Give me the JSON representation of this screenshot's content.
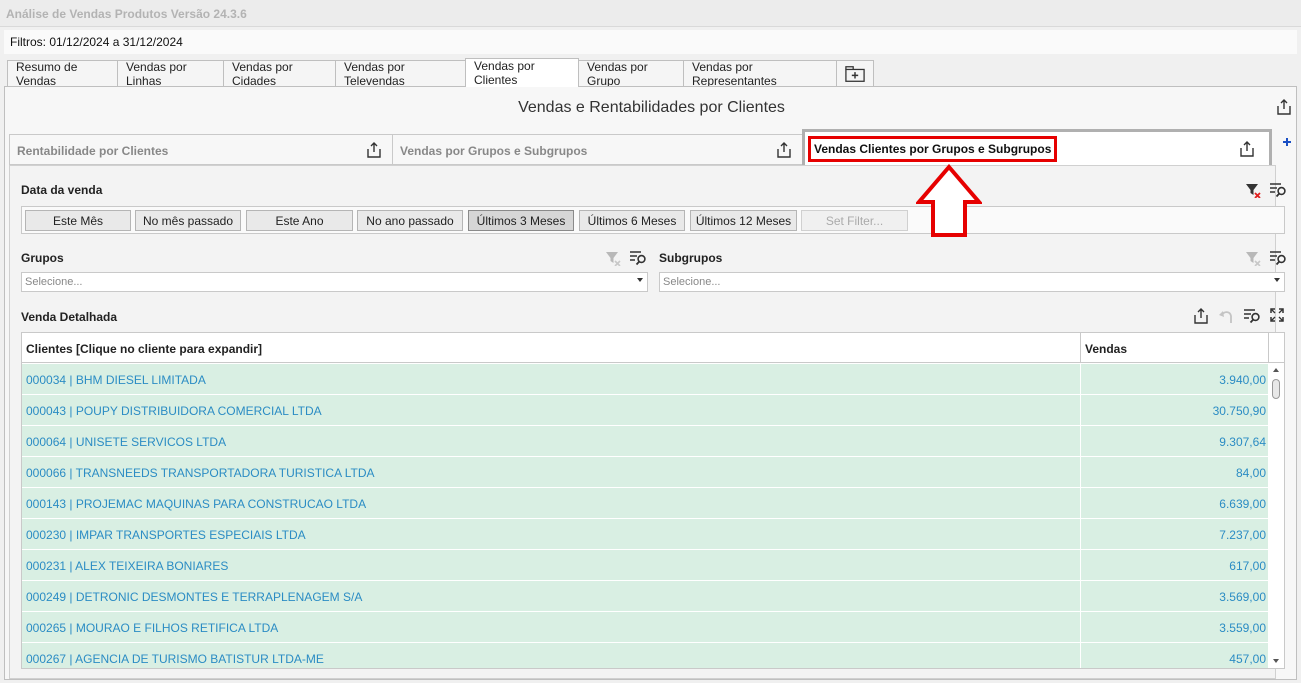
{
  "window": {
    "title": "Análise de Vendas Produtos Versão 24.3.6"
  },
  "filters": {
    "text": "Filtros: 01/12/2024 a 31/12/2024"
  },
  "tabs": [
    {
      "label": "Resumo de Vendas"
    },
    {
      "label": "Vendas por Linhas"
    },
    {
      "label": "Vendas por Cidades"
    },
    {
      "label": "Vendas por Televendas"
    },
    {
      "label": "Vendas por Clientes",
      "active": true
    },
    {
      "label": "Vendas por Grupo"
    },
    {
      "label": "Vendas por Representantes"
    }
  ],
  "dashboard": {
    "title": "Vendas e Rentabilidades por Clientes"
  },
  "subtabs": [
    {
      "label": "Rentabilidade por Clientes"
    },
    {
      "label": "Vendas por Grupos e Subgrupos"
    },
    {
      "label": "Vendas Clientes por Grupos e Subgrupos",
      "active": true
    }
  ],
  "date_filter": {
    "label": "Data da venda",
    "buttons": [
      "Este Mês",
      "No mês passado",
      "Este Ano",
      "No ano passado",
      "Últimos 3 Meses",
      "Últimos 6 Meses",
      "Últimos 12 Meses",
      "Set Filter..."
    ],
    "selected": "Últimos 3 Meses"
  },
  "grupos": {
    "label": "Grupos",
    "placeholder": "Selecione..."
  },
  "subgrupos": {
    "label": "Subgrupos",
    "placeholder": "Selecione..."
  },
  "grid": {
    "label": "Venda Detalhada",
    "columns": [
      "Clientes [Clique no cliente para expandir]",
      "Vendas"
    ],
    "rows": [
      {
        "client": "000034 | BHM DIESEL LIMITADA",
        "value": "3.940,00"
      },
      {
        "client": "000043 | POUPY DISTRIBUIDORA COMERCIAL LTDA",
        "value": "30.750,90"
      },
      {
        "client": "000064 | UNISETE SERVICOS LTDA",
        "value": "9.307,64"
      },
      {
        "client": "000066 | TRANSNEEDS TRANSPORTADORA TURISTICA LTDA",
        "value": "84,00"
      },
      {
        "client": "000143 | PROJEMAC MAQUINAS PARA CONSTRUCAO LTDA",
        "value": "6.639,00"
      },
      {
        "client": "000230 | IMPAR TRANSPORTES ESPECIAIS LTDA",
        "value": "7.237,00"
      },
      {
        "client": "000231 | ALEX TEIXEIRA BONIARES",
        "value": "617,00"
      },
      {
        "client": "000249 | DETRONIC DESMONTES E TERRAPLENAGEM S/A",
        "value": "3.569,00"
      },
      {
        "client": "000265 | MOURAO E FILHOS RETIFICA LTDA",
        "value": "3.559,00"
      },
      {
        "client": "000267 | AGENCIA DE TURISMO BATISTUR LTDA-ME",
        "value": "457,00"
      }
    ]
  },
  "colors": {
    "accent": "#2b8cc4",
    "row_bg": "#d9efe3",
    "highlight": "#e60000",
    "plus": "#1a4fc4"
  }
}
